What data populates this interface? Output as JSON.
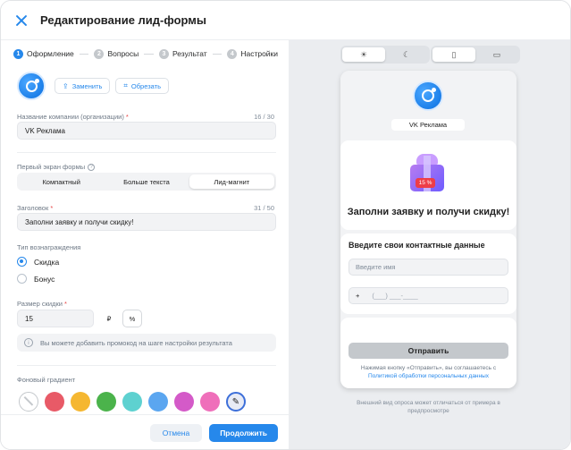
{
  "header": {
    "title": "Редактирование лид-формы"
  },
  "steps": [
    {
      "num": "1",
      "label": "Оформление"
    },
    {
      "num": "2",
      "label": "Вопросы"
    },
    {
      "num": "3",
      "label": "Результат"
    },
    {
      "num": "4",
      "label": "Настройки"
    }
  ],
  "logo_actions": {
    "replace": "Заменить",
    "crop": "Обрезать"
  },
  "company": {
    "label": "Название компании (организации)",
    "required": "*",
    "counter": "16 / 30",
    "value": "VK Реклама"
  },
  "first_screen": {
    "label": "Первый экран формы",
    "options": [
      "Компактный",
      "Больше текста",
      "Лид-магнит"
    ],
    "selected": "Лид-магнит"
  },
  "heading": {
    "label": "Заголовок",
    "required": "*",
    "counter": "31 / 50",
    "value": "Заполни заявку и получи скидку!"
  },
  "reward": {
    "label": "Тип вознаграждения",
    "options": [
      "Скидка",
      "Бонус"
    ],
    "selected": "Скидка"
  },
  "discount": {
    "label": "Размер скидки",
    "required": "*",
    "value": "15",
    "currency_options": [
      "₽",
      "%"
    ],
    "currency_selected": "%"
  },
  "info": {
    "text": "Вы можете добавить промокод на шаге настройки результата"
  },
  "gradient": {
    "label": "Фоновый градиент",
    "swatches": [
      "#e85a67",
      "#f5b731",
      "#4bb34b",
      "#5ed1d0",
      "#5ba6f0",
      "#d45ac8",
      "#ef6fba"
    ],
    "icons": {
      "none": "no-color-icon",
      "picker": "eyedropper-icon"
    }
  },
  "footer": {
    "cancel": "Отмена",
    "continue": "Продолжить"
  },
  "preview": {
    "theme_icons": [
      "sun-icon",
      "moon-icon"
    ],
    "device_icons": [
      "phone-icon",
      "desktop-icon"
    ],
    "company_name": "VK Реклама",
    "gift_badge": "15 %",
    "title": "Заполни заявку и получи скидку!",
    "contacts_title": "Введите свои контактные данные",
    "name_placeholder": "Введите имя",
    "phone_prefix": "+",
    "phone_mask": "(___) ___-____",
    "send": "Отправить",
    "agree_text": "Нажимая кнопку «Отправить», вы соглашаетесь с",
    "agree_link": "Политикой обработки персональных данных",
    "note": "Внешний вид опроса может отличаться от примера в предпросмотре"
  },
  "colors": {
    "accent": "#2688eb",
    "badge": "#ee3d48"
  }
}
